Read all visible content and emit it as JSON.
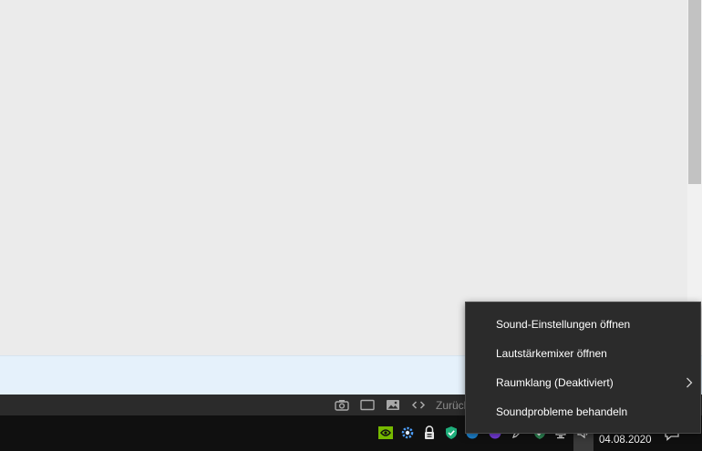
{
  "context_menu": {
    "items": [
      {
        "label": "Sound-Einstellungen öffnen",
        "has_submenu": false
      },
      {
        "label": "Lautstärkemixer öffnen",
        "has_submenu": false
      },
      {
        "label": "Raumklang (Deaktiviert)",
        "has_submenu": true
      },
      {
        "label": "Soundprobleme behandeln",
        "has_submenu": false
      }
    ]
  },
  "bottom_bar": {
    "icons": [
      "camera-icon",
      "window-icon",
      "image-icon",
      "code-icon"
    ],
    "partial_text": "Zurück"
  },
  "taskbar": {
    "tray_icons": [
      "nvidia-icon",
      "settings-gear-icon",
      "vpn-lock-icon",
      "shield-check-icon",
      "edge-icon",
      "purple-app-icon",
      "pen-icon",
      "network-icon",
      "speaker-icon"
    ],
    "date": "04.08.2020",
    "notification_icon": "action-center-icon"
  },
  "colors": {
    "menu_bg": "#2b2b2b",
    "taskbar_bg": "#101010",
    "info_strip_bg": "#e5f1fb",
    "content_bg": "#ebebeb"
  }
}
